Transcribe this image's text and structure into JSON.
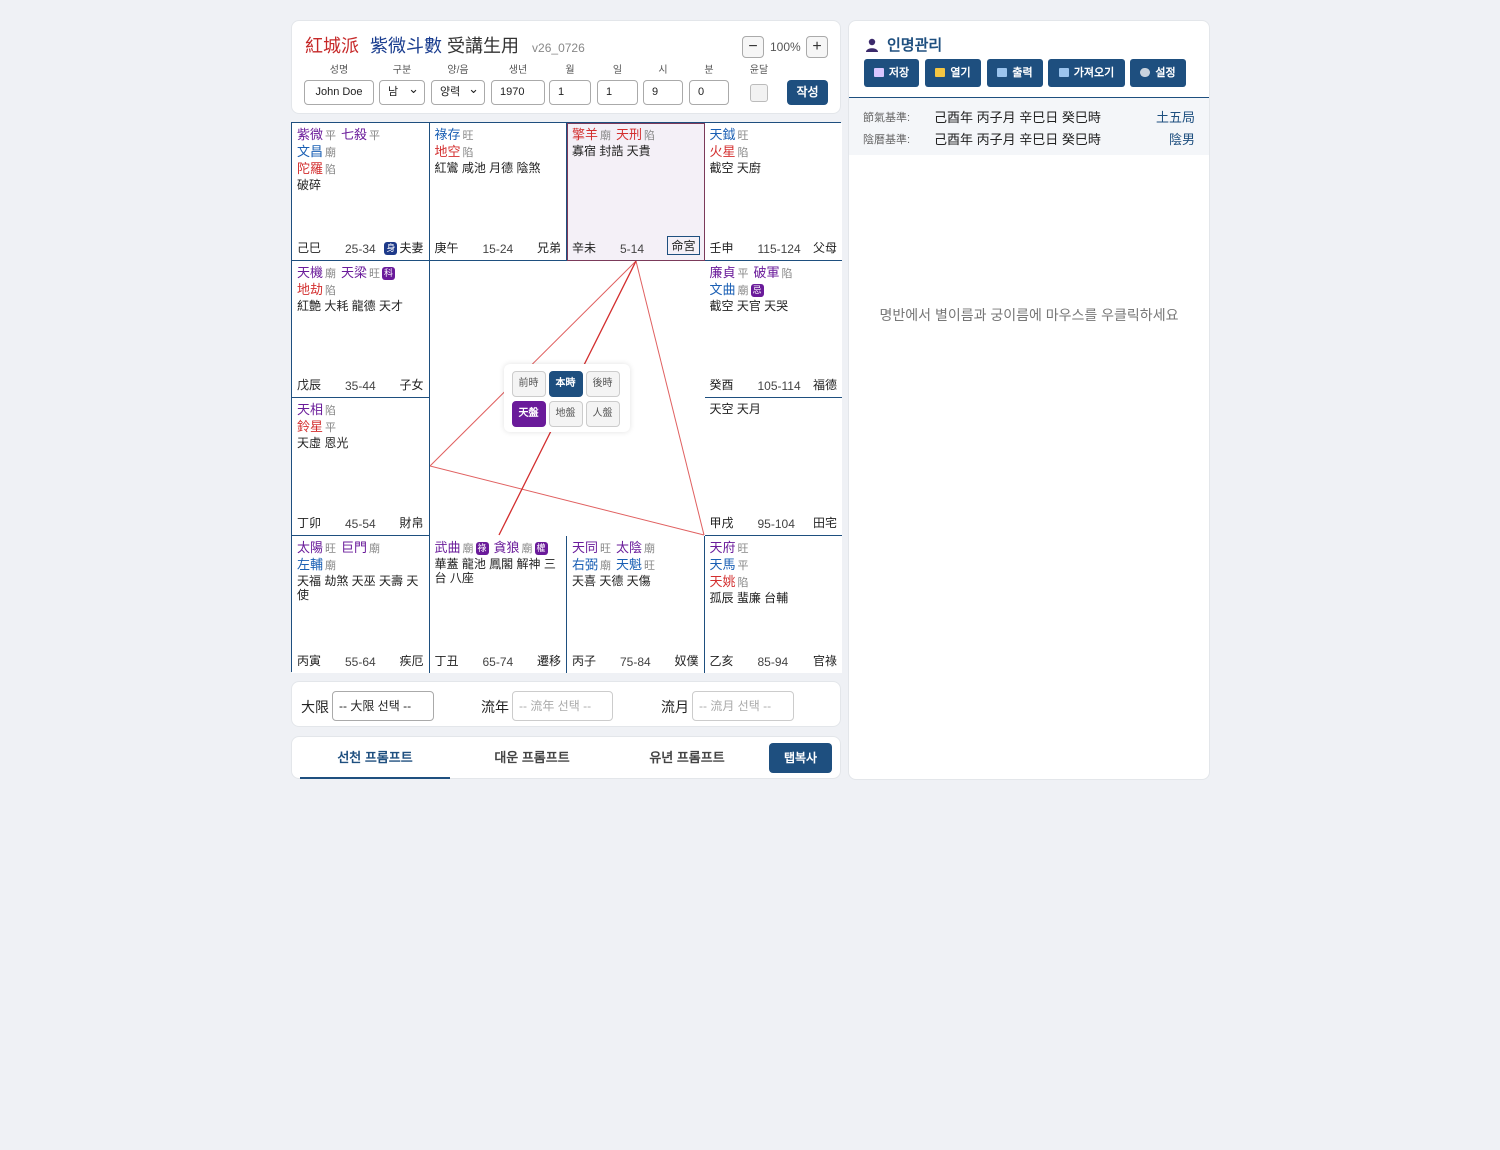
{
  "header": {
    "sect": "紅城派",
    "name": "紫微斗數",
    "sub": "受講生用",
    "version": "v26_0726",
    "zoom": "100%",
    "zoom_out": "−",
    "zoom_in": "+",
    "fields": {
      "name_label": "성명",
      "name_value": "John Doe",
      "gender_label": "구분",
      "gender_value": "남",
      "calendar_label": "양/음",
      "calendar_value": "양력",
      "year_label": "생년",
      "year_value": "1970",
      "month_label": "월",
      "month_value": "1",
      "day_label": "일",
      "day_value": "1",
      "hour_label": "시",
      "hour_value": "9",
      "minute_label": "분",
      "minute_value": "0",
      "leap_label": "윤달"
    },
    "write_button": "작성"
  },
  "palaces": [
    {
      "stars": [
        [
          {
            "n": "紫微",
            "c": "m",
            "lv": "平"
          },
          {
            "n": "七殺",
            "c": "m",
            "lv": "平"
          }
        ],
        [
          {
            "n": "文昌",
            "c": "b",
            "lv": "廟"
          }
        ],
        [
          {
            "n": "陀羅",
            "c": "r",
            "lv": "陷"
          }
        ]
      ],
      "minor": "破碎",
      "gz": "己巳",
      "age": "25-34",
      "pn": "夫妻",
      "shen": "身"
    },
    {
      "stars": [
        [
          {
            "n": "祿存",
            "c": "b",
            "lv": "旺"
          }
        ],
        [
          {
            "n": "地空",
            "c": "r",
            "lv": "陷"
          }
        ]
      ],
      "minor": "紅鸞 咸池 月德 陰煞",
      "gz": "庚午",
      "age": "15-24",
      "pn": "兄弟"
    },
    {
      "stars": [
        [
          {
            "n": "擎羊",
            "c": "r",
            "lv": "廟"
          },
          {
            "n": "天刑",
            "c": "r",
            "lv": "陷"
          }
        ]
      ],
      "minor": "寡宿 封誥 天貴",
      "gz": "辛未",
      "age": "5-14",
      "pn": "命宮"
    },
    {
      "stars": [
        [
          {
            "n": "天鉞",
            "c": "b",
            "lv": "旺"
          }
        ],
        [
          {
            "n": "火星",
            "c": "r",
            "lv": "陷"
          }
        ]
      ],
      "minor": "截空 天廚",
      "gz": "壬申",
      "age": "115-124",
      "pn": "父母"
    },
    {
      "stars": [
        [
          {
            "n": "天機",
            "c": "m",
            "lv": "廟"
          },
          {
            "n": "天梁",
            "c": "m",
            "lv": "旺",
            "hua": "科"
          }
        ],
        [
          {
            "n": "地劫",
            "c": "r",
            "lv": "陷"
          }
        ]
      ],
      "minor": "紅艶 大耗 龍德 天才",
      "gz": "戊辰",
      "age": "35-44",
      "pn": "子女"
    },
    {
      "stars": [
        [
          {
            "n": "廉貞",
            "c": "m",
            "lv": "平"
          },
          {
            "n": "破軍",
            "c": "m",
            "lv": "陷"
          }
        ],
        [
          {
            "n": "文曲",
            "c": "b",
            "lv": "廟",
            "hua": "忌"
          }
        ]
      ],
      "minor": "截空 天官 天哭",
      "gz": "癸酉",
      "age": "105-114",
      "pn": "福德"
    },
    {
      "stars": [
        [
          {
            "n": "天相",
            "c": "m",
            "lv": "陷"
          }
        ],
        [
          {
            "n": "鈴星",
            "c": "r",
            "lv": "平"
          }
        ]
      ],
      "minor": "天虛 恩光",
      "gz": "丁卯",
      "age": "45-54",
      "pn": "財帛"
    },
    {
      "stars": [],
      "minor": "天空 天月",
      "gz": "甲戌",
      "age": "95-104",
      "pn": "田宅"
    },
    {
      "stars": [
        [
          {
            "n": "太陽",
            "c": "m",
            "lv": "旺"
          },
          {
            "n": "巨門",
            "c": "m",
            "lv": "廟"
          }
        ],
        [
          {
            "n": "左輔",
            "c": "b",
            "lv": "廟"
          }
        ]
      ],
      "minor": "天福 劫煞 天巫 天壽 天使",
      "gz": "丙寅",
      "age": "55-64",
      "pn": "疾厄"
    },
    {
      "stars": [
        [
          {
            "n": "武曲",
            "c": "m",
            "lv": "廟",
            "hua": "祿"
          },
          {
            "n": "貪狼",
            "c": "m",
            "lv": "廟",
            "hua": "權"
          }
        ]
      ],
      "minor": "華蓋 龍池 鳳閣 解神 三台 八座",
      "gz": "丁丑",
      "age": "65-74",
      "pn": "遷移"
    },
    {
      "stars": [
        [
          {
            "n": "天同",
            "c": "m",
            "lv": "旺"
          },
          {
            "n": "太陰",
            "c": "m",
            "lv": "廟"
          }
        ],
        [
          {
            "n": "右弼",
            "c": "b",
            "lv": "廟"
          },
          {
            "n": "天魁",
            "c": "b",
            "lv": "旺"
          }
        ]
      ],
      "minor": "天喜 天德 天傷",
      "gz": "丙子",
      "age": "75-84",
      "pn": "奴僕"
    },
    {
      "stars": [
        [
          {
            "n": "天府",
            "c": "m",
            "lv": "旺"
          }
        ],
        [
          {
            "n": "天馬",
            "c": "b",
            "lv": "平"
          }
        ],
        [
          {
            "n": "天姚",
            "c": "r",
            "lv": "陷"
          }
        ]
      ],
      "minor": "孤辰 蜚廉 台輔",
      "gz": "乙亥",
      "age": "85-94",
      "pn": "官祿"
    }
  ],
  "center": {
    "prev_time": "前時",
    "this_time": "本時",
    "next_time": "後時",
    "heaven": "天盤",
    "earth": "地盤",
    "human": "人盤"
  },
  "limits": {
    "daxian_label": "大限",
    "daxian_value": "-- 大限 선택 --",
    "year_label": "流年",
    "year_value": "-- 流年 선택 --",
    "month_label": "流月",
    "month_value": "-- 流月 선택 --"
  },
  "tabs": {
    "natal": "선천 프롬프트",
    "daeun": "대운 프롬프트",
    "yunyeon": "유년 프롬프트",
    "copy": "탭복사"
  },
  "right_panel": {
    "title": "인명관리",
    "buttons": {
      "save": "저장",
      "open": "열기",
      "print": "출력",
      "import": "가져오기",
      "settings": "설정"
    },
    "row1_key": "節氣基準:",
    "row1_value": "己酉年 丙子月 辛巳日 癸巳時",
    "row1_right": "土五局",
    "row2_key": "陰曆基準:",
    "row2_value": "己酉年 丙子月 辛巳日 癸巳時",
    "row2_right": "陰男",
    "hint": "명반에서 별이름과 궁이름에 마우스를 우클릭하세요"
  },
  "colors": {
    "primary": "#1e4f7f",
    "purple": "#6a1b9a",
    "red": "#d32f2f",
    "blue": "#1a5fb4"
  }
}
